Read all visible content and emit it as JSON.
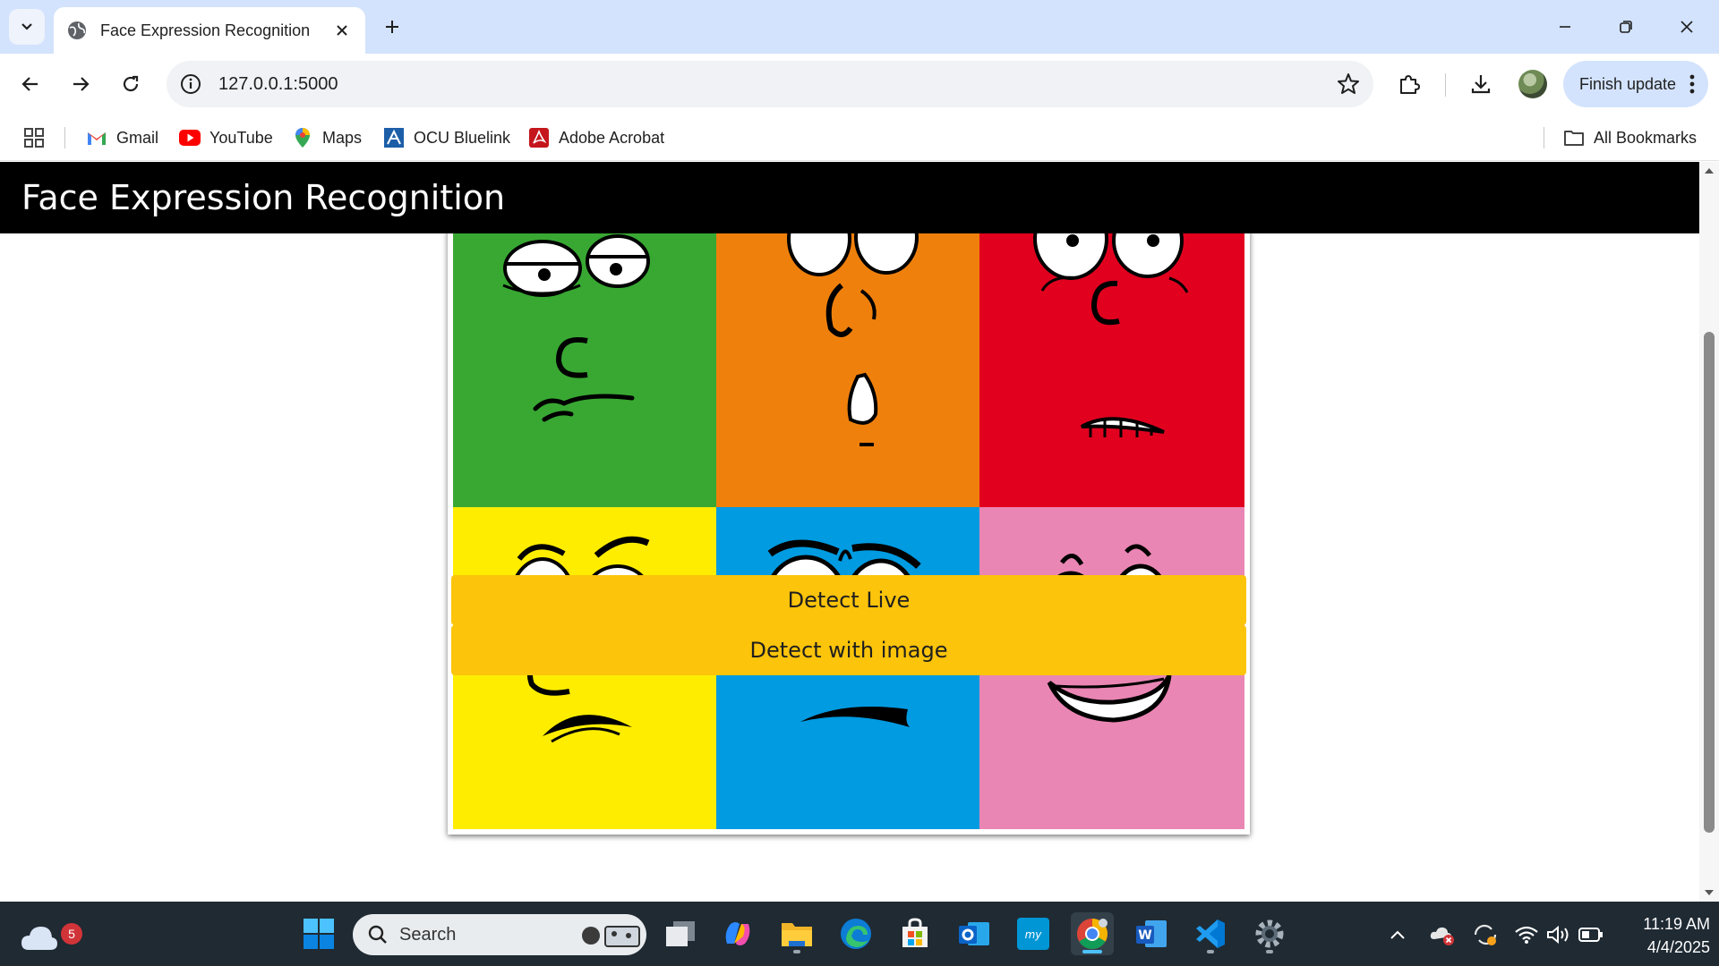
{
  "browser": {
    "tab_title": "Face Expression Recognition",
    "url": "127.0.0.1:5000",
    "finish_update_label": "Finish update",
    "bookmarks": [
      {
        "label": "Gmail"
      },
      {
        "label": "YouTube"
      },
      {
        "label": "Maps"
      },
      {
        "label": "OCU Bluelink"
      },
      {
        "label": "Adobe Acrobat"
      }
    ],
    "all_bookmarks_label": "All Bookmarks"
  },
  "page": {
    "header_title": "Face Expression Recognition",
    "faces": [
      {
        "color": "#38a832",
        "icon": "disgusted-face-icon"
      },
      {
        "color": "#f0800c",
        "icon": "surprised-face-icon"
      },
      {
        "color": "#e2001f",
        "icon": "fearful-face-icon"
      },
      {
        "color": "#ffed00",
        "icon": "annoyed-face-icon"
      },
      {
        "color": "#009be1",
        "icon": "sad-face-icon"
      },
      {
        "color": "#ea86b4",
        "icon": "happy-face-icon"
      }
    ],
    "buttons": {
      "detect_live": "Detect Live",
      "detect_image": "Detect with image"
    },
    "accent_color": "#fcc40a"
  },
  "taskbar": {
    "weather_badge": "5",
    "search_label": "Search",
    "time": "11:19 AM",
    "date": "4/4/2025"
  }
}
